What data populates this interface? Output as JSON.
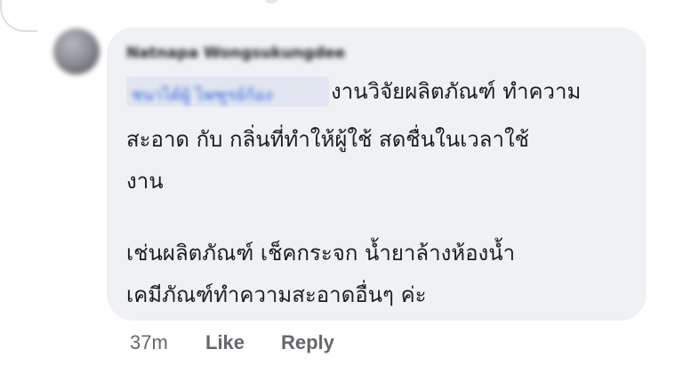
{
  "comment": {
    "author_name": "Natnapa Wongsukungdee",
    "mention_tag": "ชนาได้ผู้ ไพฑูรย์ก้อง",
    "message_lines": [
      "งานวิจัยผลิตภัณฑ์ ทำความ",
      "สะอาด กับ กลิ่นที่ทำให้ผู้ใช้ สดชื่นในเวลาใช้",
      "งาน",
      "เช่นผลิตภัณฑ์ เช็คกระจก น้ำยาล้างห้องน้ำ",
      "เคมีภัณฑ์ทำความสะอาดอื่นๆ ค่ะ"
    ]
  },
  "actions": {
    "time": "37m",
    "like_label": "Like",
    "reply_label": "Reply"
  },
  "colors": {
    "bubble_bg": "#eff1f4",
    "text": "#1c1e21",
    "meta": "#65676b",
    "mention": "#3566d8"
  }
}
